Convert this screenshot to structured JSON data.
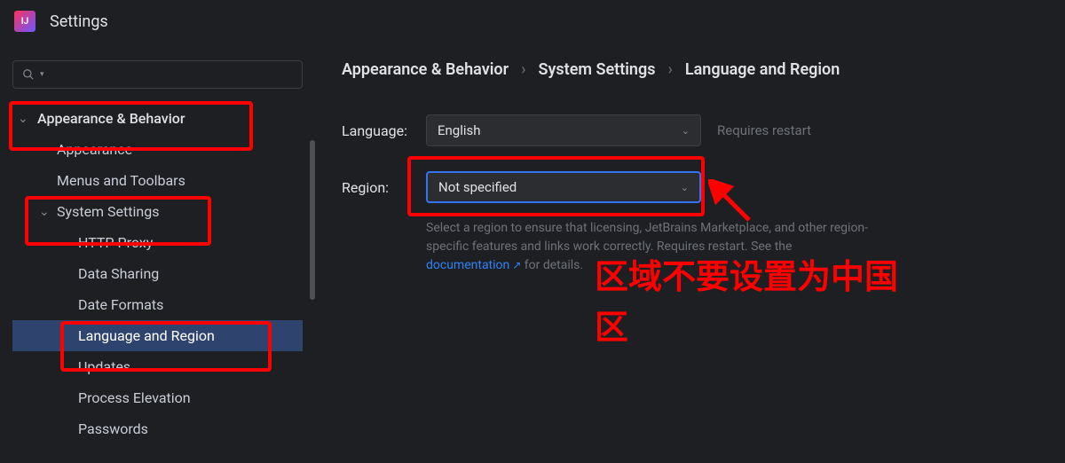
{
  "title_bar": {
    "app_icon_text": "IJ",
    "title": "Settings"
  },
  "sidebar": {
    "search_placeholder": "",
    "items": [
      {
        "label": "Appearance & Behavior",
        "level": 0,
        "expandable": true
      },
      {
        "label": "Appearance",
        "level": 1
      },
      {
        "label": "Menus and Toolbars",
        "level": 1
      },
      {
        "label": "System Settings",
        "level": 1,
        "expandable": true
      },
      {
        "label": "HTTP Proxy",
        "level": 2
      },
      {
        "label": "Data Sharing",
        "level": 2
      },
      {
        "label": "Date Formats",
        "level": 2
      },
      {
        "label": "Language and Region",
        "level": 2,
        "selected": true
      },
      {
        "label": "Updates",
        "level": 2
      },
      {
        "label": "Process Elevation",
        "level": 2
      },
      {
        "label": "Passwords",
        "level": 2
      }
    ]
  },
  "breadcrumb": {
    "part1": "Appearance & Behavior",
    "part2": "System Settings",
    "part3": "Language and Region"
  },
  "form": {
    "language_label": "Language:",
    "language_value": "English",
    "language_hint": "Requires restart",
    "region_label": "Region:",
    "region_value": "Not specified",
    "region_help_prefix": "Select a region to ensure that licensing, JetBrains Marketplace, and other region-specific features and links work correctly. Requires restart. See the ",
    "region_help_link": "documentation",
    "region_help_suffix": " for details."
  },
  "annotations": {
    "red_text_line1": "区域不要设置为中国",
    "red_text_line2": "区"
  }
}
